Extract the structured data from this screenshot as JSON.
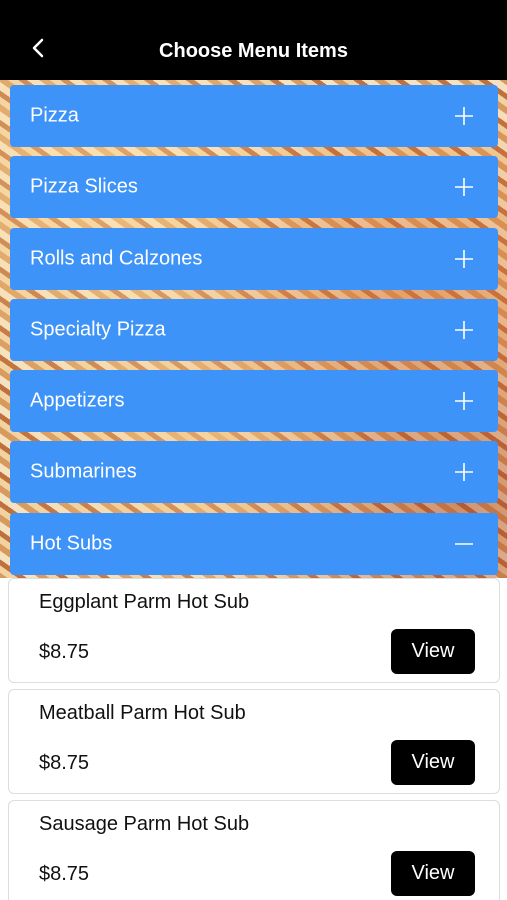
{
  "header": {
    "title": "Choose Menu Items",
    "back_icon": "chevron-left-icon"
  },
  "colors": {
    "accent": "#3d93f8",
    "header_bg": "#000000",
    "button_bg": "#000000"
  },
  "categories": [
    {
      "label": "Pizza",
      "expanded": false
    },
    {
      "label": "Pizza Slices",
      "expanded": false
    },
    {
      "label": "Rolls and Calzones",
      "expanded": false
    },
    {
      "label": "Specialty Pizza",
      "expanded": false
    },
    {
      "label": "Appetizers",
      "expanded": false
    },
    {
      "label": "Submarines",
      "expanded": false
    },
    {
      "label": "Hot Subs",
      "expanded": true
    }
  ],
  "items": [
    {
      "name": "Eggplant Parm Hot Sub",
      "price": "$8.75",
      "button": "View"
    },
    {
      "name": "Meatball Parm Hot Sub",
      "price": "$8.75",
      "button": "View"
    },
    {
      "name": "Sausage Parm Hot Sub",
      "price": "$8.75",
      "button": "View"
    }
  ]
}
